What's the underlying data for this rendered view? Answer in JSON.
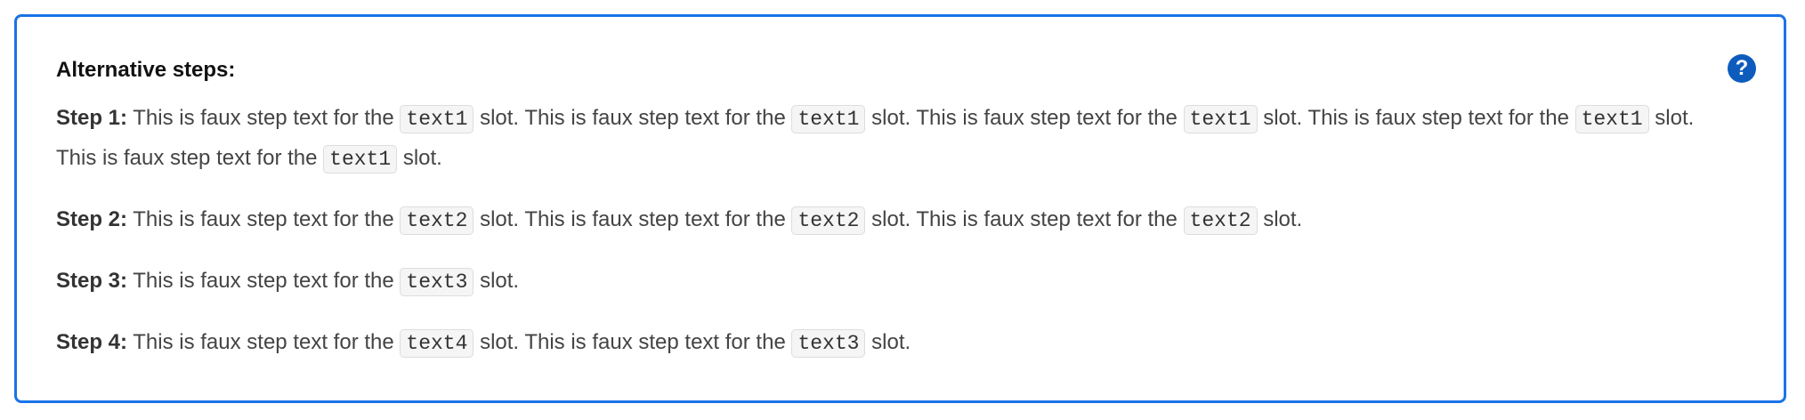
{
  "title": "Alternative steps:",
  "help_icon": "question-circle-icon",
  "accent_color": "#1a73e8",
  "steps": [
    {
      "label": "Step 1:",
      "parts": [
        {
          "t": "text",
          "v": " This is faux step text for the "
        },
        {
          "t": "code",
          "v": "text1"
        },
        {
          "t": "text",
          "v": " slot. This is faux step text for the "
        },
        {
          "t": "code",
          "v": "text1"
        },
        {
          "t": "text",
          "v": " slot. This is faux step text for the "
        },
        {
          "t": "code",
          "v": "text1"
        },
        {
          "t": "text",
          "v": " slot. This is faux step text for the "
        },
        {
          "t": "code",
          "v": "text1"
        },
        {
          "t": "text",
          "v": " slot. This is faux step text for the "
        },
        {
          "t": "code",
          "v": "text1"
        },
        {
          "t": "text",
          "v": " slot."
        }
      ]
    },
    {
      "label": "Step 2:",
      "parts": [
        {
          "t": "text",
          "v": " This is faux step text for the "
        },
        {
          "t": "code",
          "v": "text2"
        },
        {
          "t": "text",
          "v": " slot. This is faux step text for the "
        },
        {
          "t": "code",
          "v": "text2"
        },
        {
          "t": "text",
          "v": " slot. This is faux step text for the "
        },
        {
          "t": "code",
          "v": "text2"
        },
        {
          "t": "text",
          "v": " slot."
        }
      ]
    },
    {
      "label": "Step 3:",
      "parts": [
        {
          "t": "text",
          "v": " This is faux step text for the "
        },
        {
          "t": "code",
          "v": "text3"
        },
        {
          "t": "text",
          "v": " slot."
        }
      ]
    },
    {
      "label": "Step 4:",
      "parts": [
        {
          "t": "text",
          "v": " This is faux step text for the "
        },
        {
          "t": "code",
          "v": "text4"
        },
        {
          "t": "text",
          "v": " slot. This is faux step text for the "
        },
        {
          "t": "code",
          "v": "text3"
        },
        {
          "t": "text",
          "v": " slot."
        }
      ]
    }
  ]
}
